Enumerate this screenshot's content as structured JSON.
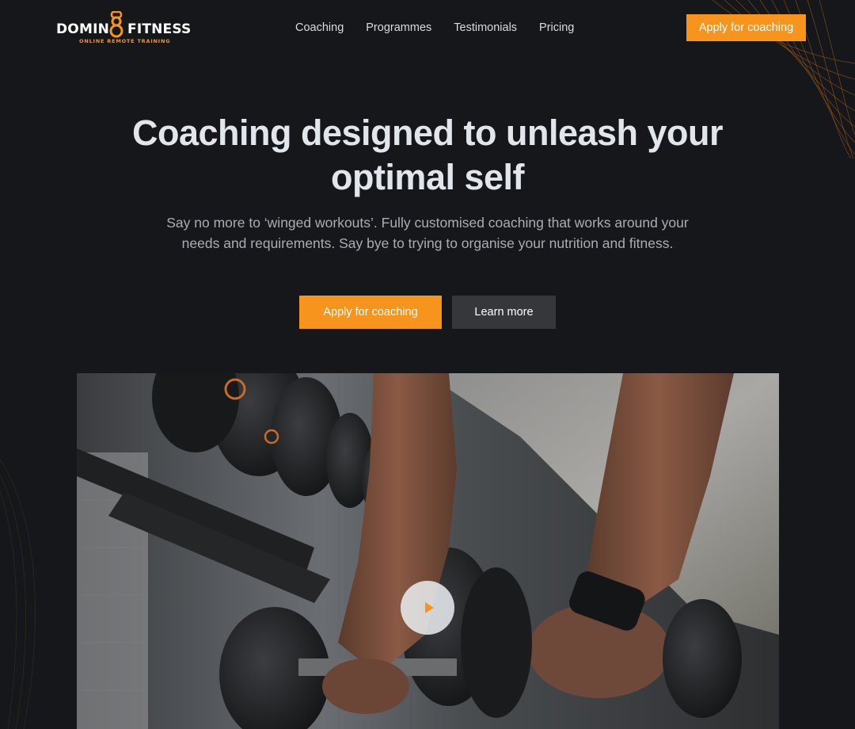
{
  "brand": {
    "name_left": "DOMIN",
    "name_right": "FITNESS",
    "tagline": "ONLINE REMOTE TRAINING",
    "accent_color": "#f7941d",
    "logo_icon": "kettlebell-eight-icon"
  },
  "nav": {
    "items": [
      {
        "label": "Coaching"
      },
      {
        "label": "Programmes"
      },
      {
        "label": "Testimonials"
      },
      {
        "label": "Pricing"
      }
    ],
    "cta_label": "Apply for coaching"
  },
  "hero": {
    "title": "Coaching designed to unleash your optimal self",
    "subtitle": "Say no more to ‘winged workouts’. Fully customised coaching that works around your needs and requirements. Say bye to trying to organise your nutrition and fitness.",
    "primary_label": "Apply for coaching",
    "secondary_label": "Learn more"
  },
  "video": {
    "play_icon": "play-icon"
  },
  "colors": {
    "background": "#15171a",
    "accent": "#f7941d",
    "secondary_button": "#35373b",
    "title": "#e1e6ec",
    "subtitle": "#a9aeb5"
  }
}
